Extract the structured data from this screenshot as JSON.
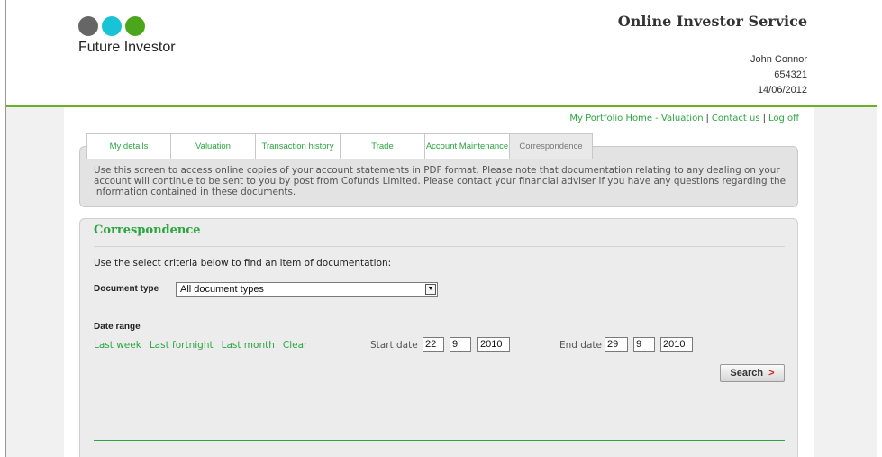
{
  "colors": {
    "accent_green": "#2aa53f",
    "logo_gray": "#666666",
    "logo_cyan": "#19c3d6",
    "logo_green": "#4ca61c",
    "rule_green": "#6ab023"
  },
  "brand": {
    "name": "Future Investor",
    "service_title": "Online Investor Service"
  },
  "user": {
    "name": "John Connor",
    "account_number": "654321",
    "date": "14/06/2012"
  },
  "top_links": [
    "My Portfolio Home - Valuation",
    "Contact us",
    "Log off"
  ],
  "tabs": [
    {
      "label": "My details",
      "active": false
    },
    {
      "label": "Valuation",
      "active": false
    },
    {
      "label": "Transaction history",
      "active": false
    },
    {
      "label": "Trade",
      "active": false
    },
    {
      "label": "Account Maintenance",
      "active": false
    },
    {
      "label": "Correspondence",
      "active": true
    }
  ],
  "info_text": "Use this screen to access online copies of your account statements in PDF format. Please note that documentation relating to any dealing on your account will continue to be sent to you by post from Cofunds Limited. Please contact your financial adviser if you have any questions regarding the information contained in these documents.",
  "section": {
    "title": "Correspondence",
    "criteria_text": "Use the select criteria below to find an item of documentation:",
    "document_type_label": "Document type",
    "document_type_value": "All document types",
    "date_range_label": "Date range",
    "quick_links": [
      "Last week",
      "Last fortnight",
      "Last month",
      "Clear"
    ],
    "start_date_label": "Start date",
    "start_date": {
      "day": "22",
      "month": "9",
      "year": "2010"
    },
    "end_date_label": "End date",
    "end_date": {
      "day": "29",
      "month": "9",
      "year": "2010"
    },
    "search_label": "Search",
    "search_arrow": ">"
  }
}
